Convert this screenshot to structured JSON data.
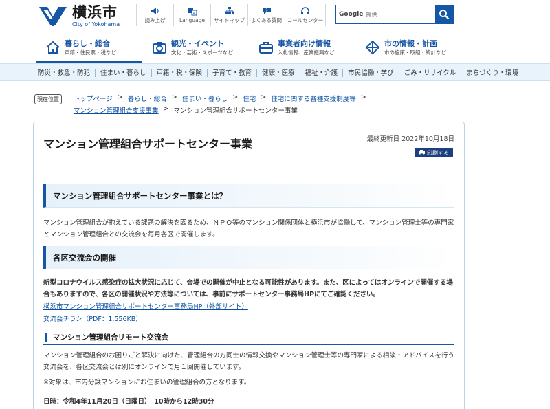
{
  "header": {
    "logo_kanji": "横浜市",
    "logo_en": "City of Yokohama",
    "tools": [
      {
        "label": "読み上げ",
        "icon": "speaker-icon"
      },
      {
        "label": "Language",
        "icon": "translate-icon"
      },
      {
        "label": "サイトマップ",
        "icon": "sitemap-icon"
      },
      {
        "label": "よくある質問",
        "icon": "question-icon"
      },
      {
        "label": "コールセンター",
        "icon": "headset-icon"
      }
    ],
    "search": {
      "brand": "Google",
      "placeholder": "提供"
    }
  },
  "catnav": [
    {
      "title": "暮らし・総合",
      "sub": "戸籍・住民票・税など",
      "icon": "house-icon"
    },
    {
      "title": "観光・イベント",
      "sub": "文化・芸術・スポーツなど",
      "icon": "camera-icon"
    },
    {
      "title": "事業者向け情報",
      "sub": "入札情報、産業振興など",
      "icon": "briefcase-icon"
    },
    {
      "title": "市の情報・計画",
      "sub": "市の施策・取組・統計など",
      "icon": "info-diamond-icon"
    }
  ],
  "subnav": [
    "防災・救急・防犯",
    "住まい・暮らし",
    "戸籍・税・保険",
    "子育て・教育",
    "健康・医療",
    "福祉・介護",
    "市民協働・学び",
    "ごみ・リサイクル",
    "まちづくり・環境"
  ],
  "breadcrumb": {
    "badge": "現在位置",
    "line1": [
      "トップページ",
      "暮らし・総合",
      "住まい・暮らし",
      "住宅",
      "住宅に関する各種支援制度等"
    ],
    "line2_link": "マンション管理組合支援事業",
    "current": "マンション管理組合サポートセンター事業"
  },
  "main": {
    "title": "マンション管理組合サポートセンター事業",
    "updated": "最終更新日 2022年10月18日",
    "print_label": "印刷する",
    "h2_1": "マンション管理組合サポートセンター事業とは？",
    "p1": "マンション管理組合が抱えている課題の解決を図るため、ＮＰＯ等のマンション関係団体と横浜市が協働して、マンション管理士等の専門家とマンション管理組合との交流会を毎月各区で開催します。",
    "h2_2": "各区交流会の開催",
    "p2": "新型コロナウイルス感染症の拡大状況に応じて、会場での開催が中止となる可能性があります。また、区によってはオンラインで開催する場合もありますので、各区の開催状況や方法等については、事前にサポートセンター事務局HPにてご確認ください。",
    "link1": "横浜市マンション管理組合サポートセンター事務局HP（外部サイト）",
    "link2": "交流会チラシ（PDF：1,556KB）",
    "h3": "マンション管理組合リモート交流会",
    "p3": "マンション管理組合のお困りごと解決に向けた、管理組合の方同士の情報交換やマンション管理士等の専門家による相談・アドバイスを行う交流会を、各区交流会とは別にオンラインで月１回開催しています。",
    "p4": "※対象は、市内分譲マンションにお住まいの管理組合の方となります。",
    "p5": "日時：令和4年11月20日（日曜日）　10時から12時30分"
  },
  "colors": {
    "brand_blue": "#1756a5",
    "subnav_bg": "#e8f3fb",
    "link": "#0b4fa0"
  }
}
